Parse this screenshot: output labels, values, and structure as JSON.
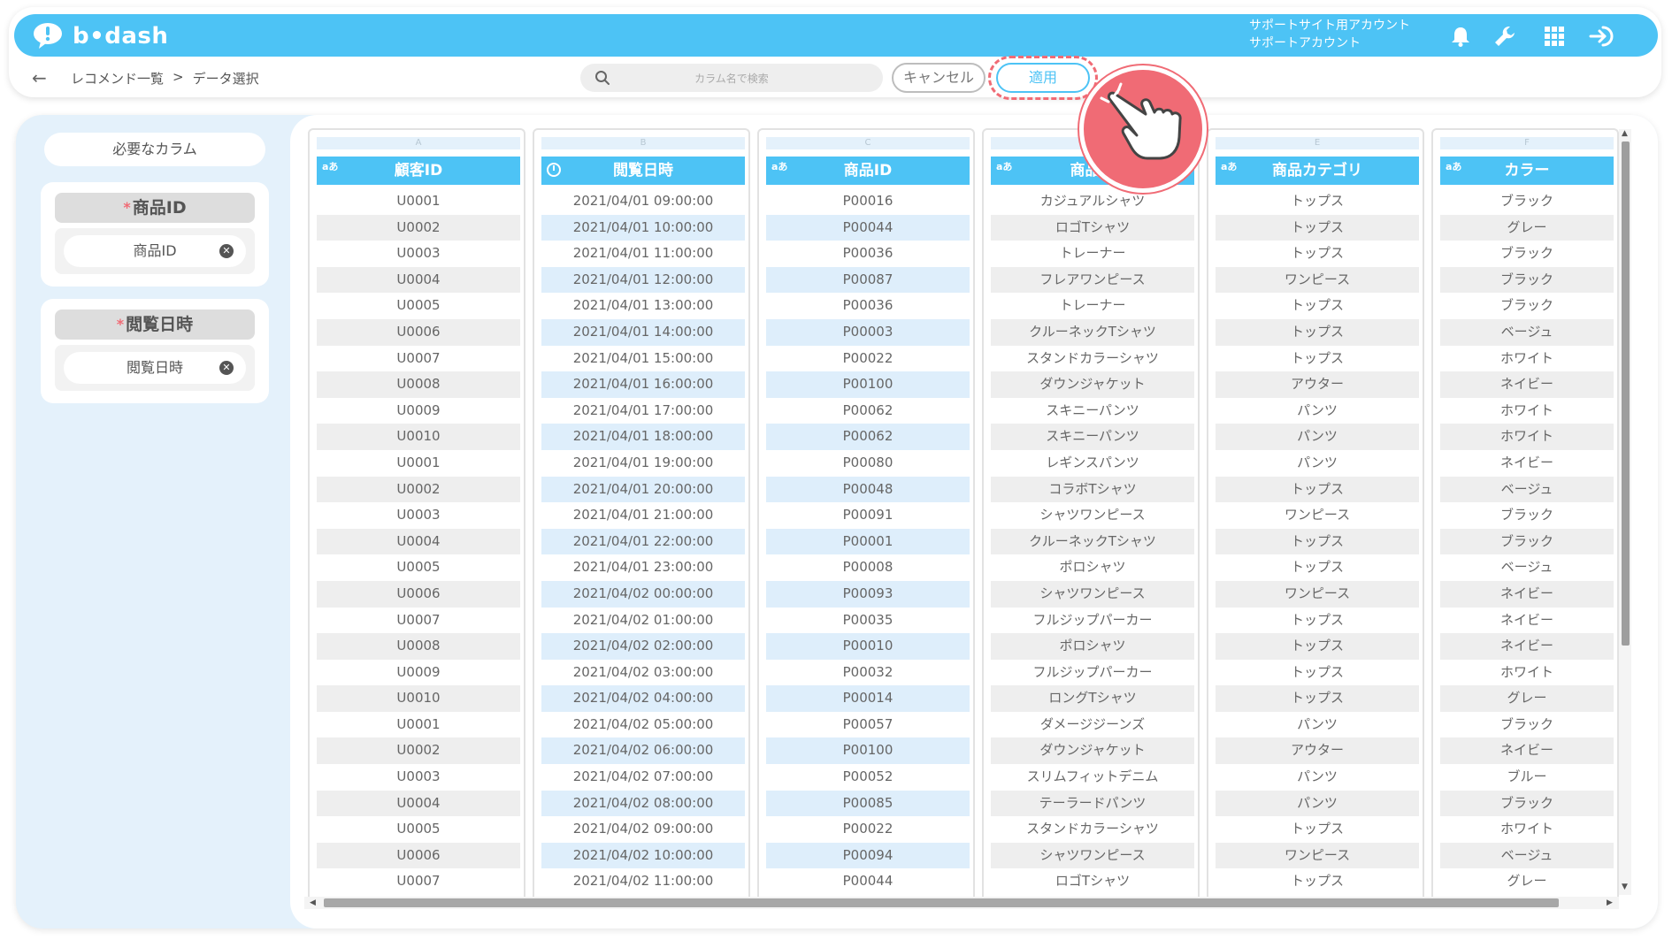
{
  "app": {
    "logo_text": "b•dash",
    "account_line1": "サポートサイト用アカウント",
    "account_line2": "サポートアカウント"
  },
  "header_icons": [
    "bell-icon",
    "wrench-icon",
    "grid-icon",
    "logout-icon"
  ],
  "breadcrumb": {
    "parent": "レコメンド一覧",
    "separator": ">",
    "current": "データ選択"
  },
  "search": {
    "placeholder": "カラム名で検索"
  },
  "actions": {
    "cancel": "キャンセル",
    "apply": "適用"
  },
  "sidebar": {
    "title": "必要なカラム",
    "required": [
      {
        "star": "*",
        "label": "商品ID",
        "chip": "商品ID"
      },
      {
        "star": "*",
        "label": "閲覧日時",
        "chip": "閲覧日時"
      }
    ]
  },
  "columns": [
    {
      "letter": "A",
      "name": "顧客ID",
      "type": "text",
      "type_label": "aあ",
      "cells": [
        "U0001",
        "U0002",
        "U0003",
        "U0004",
        "U0005",
        "U0006",
        "U0007",
        "U0008",
        "U0009",
        "U0010",
        "U0001",
        "U0002",
        "U0003",
        "U0004",
        "U0005",
        "U0006",
        "U0007",
        "U0008",
        "U0009",
        "U0010",
        "U0001",
        "U0002",
        "U0003",
        "U0004",
        "U0005",
        "U0006",
        "U0007"
      ]
    },
    {
      "letter": "B",
      "name": "閲覧日時",
      "type": "datetime",
      "type_label": "",
      "cells": [
        "2021/04/01 09:00:00",
        "2021/04/01 10:00:00",
        "2021/04/01 11:00:00",
        "2021/04/01 12:00:00",
        "2021/04/01 13:00:00",
        "2021/04/01 14:00:00",
        "2021/04/01 15:00:00",
        "2021/04/01 16:00:00",
        "2021/04/01 17:00:00",
        "2021/04/01 18:00:00",
        "2021/04/01 19:00:00",
        "2021/04/01 20:00:00",
        "2021/04/01 21:00:00",
        "2021/04/01 22:00:00",
        "2021/04/01 23:00:00",
        "2021/04/02 00:00:00",
        "2021/04/02 01:00:00",
        "2021/04/02 02:00:00",
        "2021/04/02 03:00:00",
        "2021/04/02 04:00:00",
        "2021/04/02 05:00:00",
        "2021/04/02 06:00:00",
        "2021/04/02 07:00:00",
        "2021/04/02 08:00:00",
        "2021/04/02 09:00:00",
        "2021/04/02 10:00:00",
        "2021/04/02 11:00:00"
      ]
    },
    {
      "letter": "C",
      "name": "商品ID",
      "type": "text",
      "type_label": "aあ",
      "cells": [
        "P00016",
        "P00044",
        "P00036",
        "P00087",
        "P00036",
        "P00003",
        "P00022",
        "P00100",
        "P00062",
        "P00062",
        "P00080",
        "P00048",
        "P00091",
        "P00001",
        "P00008",
        "P00093",
        "P00035",
        "P00010",
        "P00032",
        "P00014",
        "P00057",
        "P00100",
        "P00052",
        "P00085",
        "P00022",
        "P00094",
        "P00044"
      ]
    },
    {
      "letter": "D",
      "name": "商品名",
      "type": "text",
      "type_label": "aあ",
      "cells": [
        "カジュアルシャツ",
        "ロゴTシャツ",
        "トレーナー",
        "フレアワンピース",
        "トレーナー",
        "クルーネックTシャツ",
        "スタンドカラーシャツ",
        "ダウンジャケット",
        "スキニーパンツ",
        "スキニーパンツ",
        "レギンスパンツ",
        "コラボTシャツ",
        "シャツワンピース",
        "クルーネックTシャツ",
        "ポロシャツ",
        "シャツワンピース",
        "フルジップパーカー",
        "ポロシャツ",
        "フルジップパーカー",
        "ロングTシャツ",
        "ダメージジーンズ",
        "ダウンジャケット",
        "スリムフィットデニム",
        "テーラードパンツ",
        "スタンドカラーシャツ",
        "シャツワンピース",
        "ロゴTシャツ"
      ]
    },
    {
      "letter": "E",
      "name": "商品カテゴリ",
      "type": "text",
      "type_label": "aあ",
      "cells": [
        "トップス",
        "トップス",
        "トップス",
        "ワンピース",
        "トップス",
        "トップス",
        "トップス",
        "アウター",
        "パンツ",
        "パンツ",
        "パンツ",
        "トップス",
        "ワンピース",
        "トップス",
        "トップス",
        "ワンピース",
        "トップス",
        "トップス",
        "トップス",
        "トップス",
        "パンツ",
        "アウター",
        "パンツ",
        "パンツ",
        "トップス",
        "ワンピース",
        "トップス"
      ]
    },
    {
      "letter": "F",
      "name": "カラー",
      "type": "text",
      "type_label": "aあ",
      "cells": [
        "ブラック",
        "グレー",
        "ブラック",
        "ブラック",
        "ブラック",
        "ベージュ",
        "ホワイト",
        "ネイビー",
        "ホワイト",
        "ホワイト",
        "ネイビー",
        "ベージュ",
        "ブラック",
        "ブラック",
        "ベージュ",
        "ネイビー",
        "ネイビー",
        "ネイビー",
        "ホワイト",
        "グレー",
        "ブラック",
        "ネイビー",
        "ブルー",
        "ブラック",
        "ホワイト",
        "ベージュ",
        "グレー"
      ]
    }
  ],
  "colors": {
    "accent": "#4dc3f5",
    "highlight": "#f06b75",
    "panel": "#e4f1fb"
  }
}
